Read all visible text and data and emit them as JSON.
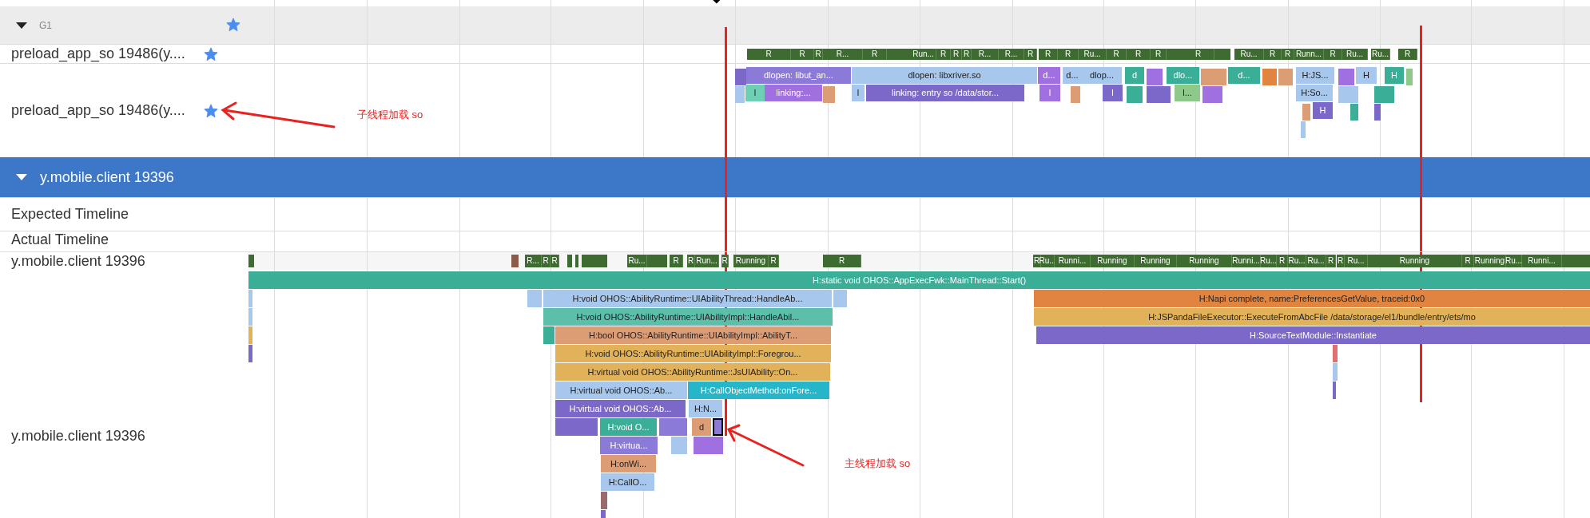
{
  "group": {
    "name": "G1",
    "expanded": true,
    "starred": true
  },
  "threads": [
    {
      "name": "preload_app_so 19486(y....",
      "starred": true,
      "states": [
        {
          "label": "R"
        },
        {
          "label": "R"
        },
        {
          "label": "R"
        },
        {
          "label": "R..."
        },
        {
          "label": "R"
        },
        {
          "label": "Run..."
        },
        {
          "label": "R"
        },
        {
          "label": "R"
        },
        {
          "label": "R"
        },
        {
          "label": "R..."
        },
        {
          "label": "R..."
        },
        {
          "label": "R"
        },
        {
          "label": "R"
        },
        {
          "label": "R"
        },
        {
          "label": "Ru..."
        },
        {
          "label": "R"
        },
        {
          "label": "R"
        },
        {
          "label": "R"
        },
        {
          "label": "R"
        },
        {
          "label": "Ru..."
        },
        {
          "label": "R"
        },
        {
          "label": "R"
        },
        {
          "label": "Runn..."
        },
        {
          "label": "R"
        },
        {
          "label": "Ru..."
        },
        {
          "label": "Ru..."
        },
        {
          "label": "R"
        }
      ]
    },
    {
      "name": "preload_app_so 19486(y....",
      "starred": true,
      "slices": [
        {
          "label": "dlopen:  libut_an...",
          "color": "#8c7ad8",
          "selected": false
        },
        {
          "label": "dlopen:  libxriver.so",
          "color": "#a7c7ec",
          "selected": false
        },
        {
          "label": "d...",
          "color": "#a070e0",
          "selected": false
        },
        {
          "label": "d...",
          "color": "#a7c7ec",
          "selected": false
        },
        {
          "label": "dlop...",
          "color": "#a7c7ec",
          "selected": false
        },
        {
          "label": "d",
          "color": "#3aae97",
          "selected": false
        },
        {
          "label": "dlo...",
          "color": "#3aae97",
          "selected": false
        },
        {
          "label": "d...",
          "color": "#3aae97",
          "selected": false
        },
        {
          "label": "H:JS...",
          "color": "#a7c7ec",
          "selected": false
        },
        {
          "label": "H",
          "color": "#a7c7ec",
          "selected": false
        },
        {
          "label": "H",
          "color": "#3aae97",
          "selected": false
        },
        {
          "label": "l",
          "color": "#6fcfb4",
          "selected": false
        },
        {
          "label": "linking:...",
          "color": "#a070e0",
          "selected": false
        },
        {
          "label": "l",
          "color": "#a7c7ec",
          "selected": false
        },
        {
          "label": "linking: entry so /data/stor...",
          "color": "#7b68c8",
          "selected": false
        },
        {
          "label": "l",
          "color": "#a070e0",
          "selected": false
        },
        {
          "label": "l",
          "color": "#7b68c8",
          "selected": false
        },
        {
          "label": "l...",
          "color": "#8fc98a",
          "selected": false
        },
        {
          "label": "H:So...",
          "color": "#a7c7ec",
          "selected": false
        },
        {
          "label": "H",
          "color": "#7b68c8",
          "selected": false
        }
      ]
    }
  ],
  "process": {
    "name": "y.mobile.client 19396",
    "expanded": true
  },
  "tracks": [
    {
      "name": "Expected Timeline"
    },
    {
      "name": "Actual Timeline"
    }
  ],
  "main_thread": {
    "name": "y.mobile.client 19396",
    "states": [
      {
        "label": "R..."
      },
      {
        "label": "R"
      },
      {
        "label": "R"
      },
      {
        "label": "Ru..."
      },
      {
        "label": "R"
      },
      {
        "label": "R"
      },
      {
        "label": "Run..."
      },
      {
        "label": "R"
      },
      {
        "label": "Running"
      },
      {
        "label": "R"
      },
      {
        "label": "R"
      },
      {
        "label": "R"
      },
      {
        "label": "Ru..."
      },
      {
        "label": "Runni..."
      },
      {
        "label": "Running"
      },
      {
        "label": "Running"
      },
      {
        "label": "Running"
      },
      {
        "label": "Runni..."
      },
      {
        "label": "Ru..."
      },
      {
        "label": "R"
      },
      {
        "label": "Ru..."
      },
      {
        "label": "Ru..."
      },
      {
        "label": "R"
      },
      {
        "label": "R"
      },
      {
        "label": "Ru..."
      },
      {
        "label": "Running"
      },
      {
        "label": "R"
      },
      {
        "label": "Running"
      },
      {
        "label": "Ru..."
      },
      {
        "label": "Runni..."
      }
    ],
    "stack_label": "y.mobile.client 19396",
    "slices": [
      {
        "label": "H:static void OHOS::AppExecFwk::MainThread::Start()",
        "color": "#3aae97",
        "selected": false
      },
      {
        "label": "H:void OHOS::AbilityRuntime::UIAbilityThread::HandleAb...",
        "color": "#a7c7ec",
        "selected": false
      },
      {
        "label": "H:Napi complete, name:PreferencesGetValue, traceid:0x0",
        "color": "#e0843f",
        "selected": false
      },
      {
        "label": "H:void OHOS::AbilityRuntime::UIAbilityImpl::HandleAbil...",
        "color": "#5bbfa9",
        "selected": false
      },
      {
        "label": "H:JSPandaFileExecutor::ExecuteFromAbcFile /data/storage/el1/bundle/entry/ets/mo",
        "color": "#e2b25a",
        "selected": false
      },
      {
        "label": "H:bool OHOS::AbilityRuntime::UIAbilityImpl::AbilityT...",
        "color": "#dc9c74",
        "selected": false
      },
      {
        "label": "H:SourceTextModule::Instantiate",
        "color": "#7b68c8",
        "selected": false
      },
      {
        "label": "H:void OHOS::AbilityRuntime::UIAbilityImpl::Foregrou...",
        "color": "#e2b25a",
        "selected": false
      },
      {
        "label": "H:virtual void OHOS::AbilityRuntime::JsUIAbility::On...",
        "color": "#e2b25a",
        "selected": false
      },
      {
        "label": "H:virtual void OHOS::Ab...",
        "color": "#a7c7ec",
        "selected": false
      },
      {
        "label": "H:CallObjectMethod:onFore...",
        "color": "#27b5c9",
        "selected": false
      },
      {
        "label": "H:virtual void OHOS::Ab...",
        "color": "#7b68c8",
        "selected": false
      },
      {
        "label": "H:N...",
        "color": "#a7c7ec",
        "selected": false
      },
      {
        "label": "H:void O...",
        "color": "#3aae97",
        "selected": false
      },
      {
        "label": "d",
        "color": "#dc9c74",
        "selected": false
      },
      {
        "color": "#8c7ad8",
        "selected": true
      },
      {
        "label": "H:virtua...",
        "color": "#8c7ad8",
        "selected": false
      },
      {
        "label": "H:onWi...",
        "color": "#dc9c74",
        "selected": false
      },
      {
        "label": "H:CallO...",
        "color": "#a7c7ec",
        "selected": false
      }
    ]
  },
  "annotations": [
    {
      "text": "子线程加载 so"
    },
    {
      "text": "主线程加载 so"
    }
  ]
}
